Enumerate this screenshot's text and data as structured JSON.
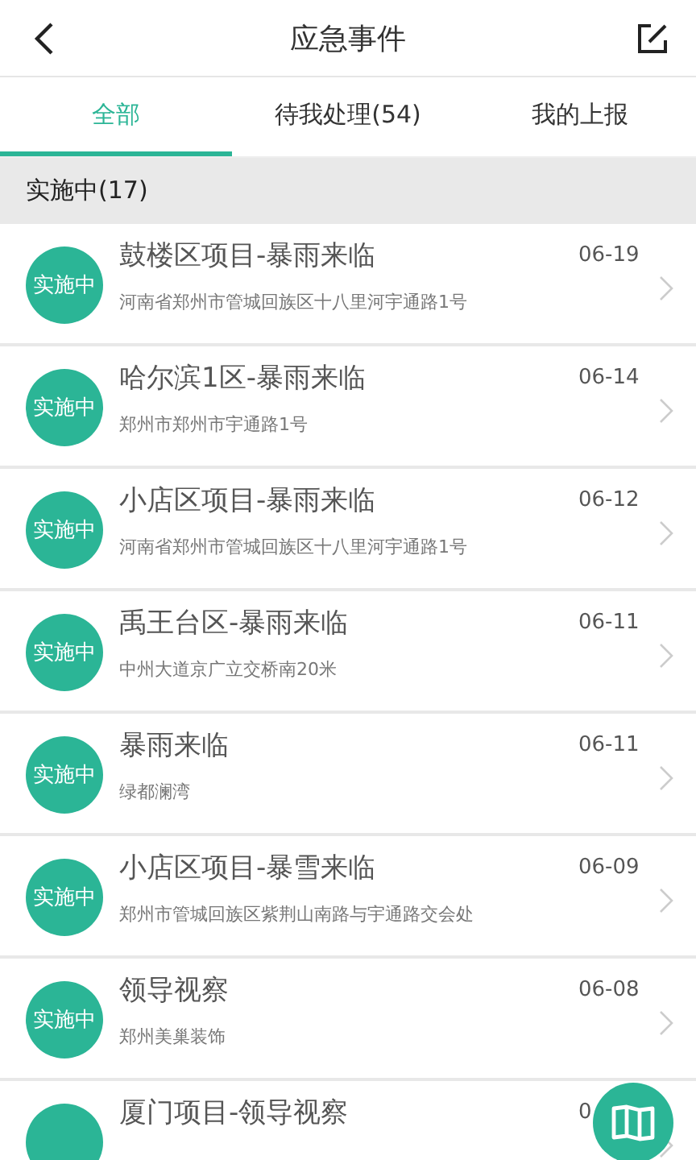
{
  "header": {
    "title": "应急事件"
  },
  "tabs": [
    {
      "label": "全部",
      "selected": true
    },
    {
      "label": "待我处理(54)",
      "selected": false
    },
    {
      "label": "我的上报",
      "selected": false
    }
  ],
  "section": {
    "title": "实施中(17)"
  },
  "events": [
    {
      "status": "实施中",
      "title": "鼓楼区项目-暴雨来临",
      "date": "06-19",
      "address": "河南省郑州市管城回族区十八里河宇通路1号"
    },
    {
      "status": "实施中",
      "title": "哈尔滨1区-暴雨来临",
      "date": "06-14",
      "address": "郑州市郑州市宇通路1号"
    },
    {
      "status": "实施中",
      "title": "小店区项目-暴雨来临",
      "date": "06-12",
      "address": "河南省郑州市管城回族区十八里河宇通路1号"
    },
    {
      "status": "实施中",
      "title": "禹王台区-暴雨来临",
      "date": "06-11",
      "address": "中州大道京广立交桥南20米"
    },
    {
      "status": "实施中",
      "title": "暴雨来临",
      "date": "06-11",
      "address": "绿都澜湾"
    },
    {
      "status": "实施中",
      "title": "小店区项目-暴雪来临",
      "date": "06-09",
      "address": "郑州市管城回族区紫荆山南路与宇通路交会处"
    },
    {
      "status": "实施中",
      "title": "领导视察",
      "date": "06-08",
      "address": "郑州美巢装饰"
    },
    {
      "title": "厦门项目-领导视察",
      "date": "0"
    }
  ]
}
